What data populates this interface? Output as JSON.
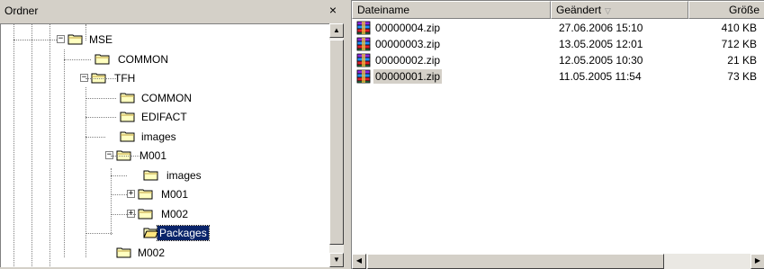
{
  "folder_pane": {
    "title": "Ordner",
    "close_glyph": "×",
    "tree": [
      {
        "label": "MSE",
        "expander": "−"
      },
      {
        "label": "COMMON",
        "expander": ""
      },
      {
        "label": "TFH",
        "expander": "−"
      },
      {
        "label": "COMMON",
        "expander": ""
      },
      {
        "label": "EDIFACT",
        "expander": ""
      },
      {
        "label": "images",
        "expander": ""
      },
      {
        "label": "M001",
        "expander": "−"
      },
      {
        "label": "images",
        "expander": ""
      },
      {
        "label": "M001",
        "expander": "+"
      },
      {
        "label": "M002",
        "expander": "+"
      },
      {
        "label": "Packages",
        "expander": "",
        "selected": true
      },
      {
        "label": "M002",
        "expander": ""
      }
    ]
  },
  "file_pane": {
    "columns": {
      "name": "Dateiname",
      "modified": "Geändert",
      "modified_sort": "▽",
      "size": "Größe"
    },
    "files": [
      {
        "name": "00000004.zip",
        "modified": "27.06.2006 15:10",
        "size": "410 KB"
      },
      {
        "name": "00000003.zip",
        "modified": "13.05.2005 12:01",
        "size": "712 KB"
      },
      {
        "name": "00000002.zip",
        "modified": "12.05.2005 10:30",
        "size": "21 KB"
      },
      {
        "name": "00000001.zip",
        "modified": "11.05.2005 11:54",
        "size": "73 KB",
        "selected": true
      }
    ]
  },
  "icons": {
    "folder": "folder-icon",
    "open_folder": "folder-open-icon",
    "archive": "winrar-archive-icon"
  },
  "colors": {
    "selection": "#0a246a",
    "face": "#d4d0c8",
    "folder_yellow": "#ffffc0"
  }
}
